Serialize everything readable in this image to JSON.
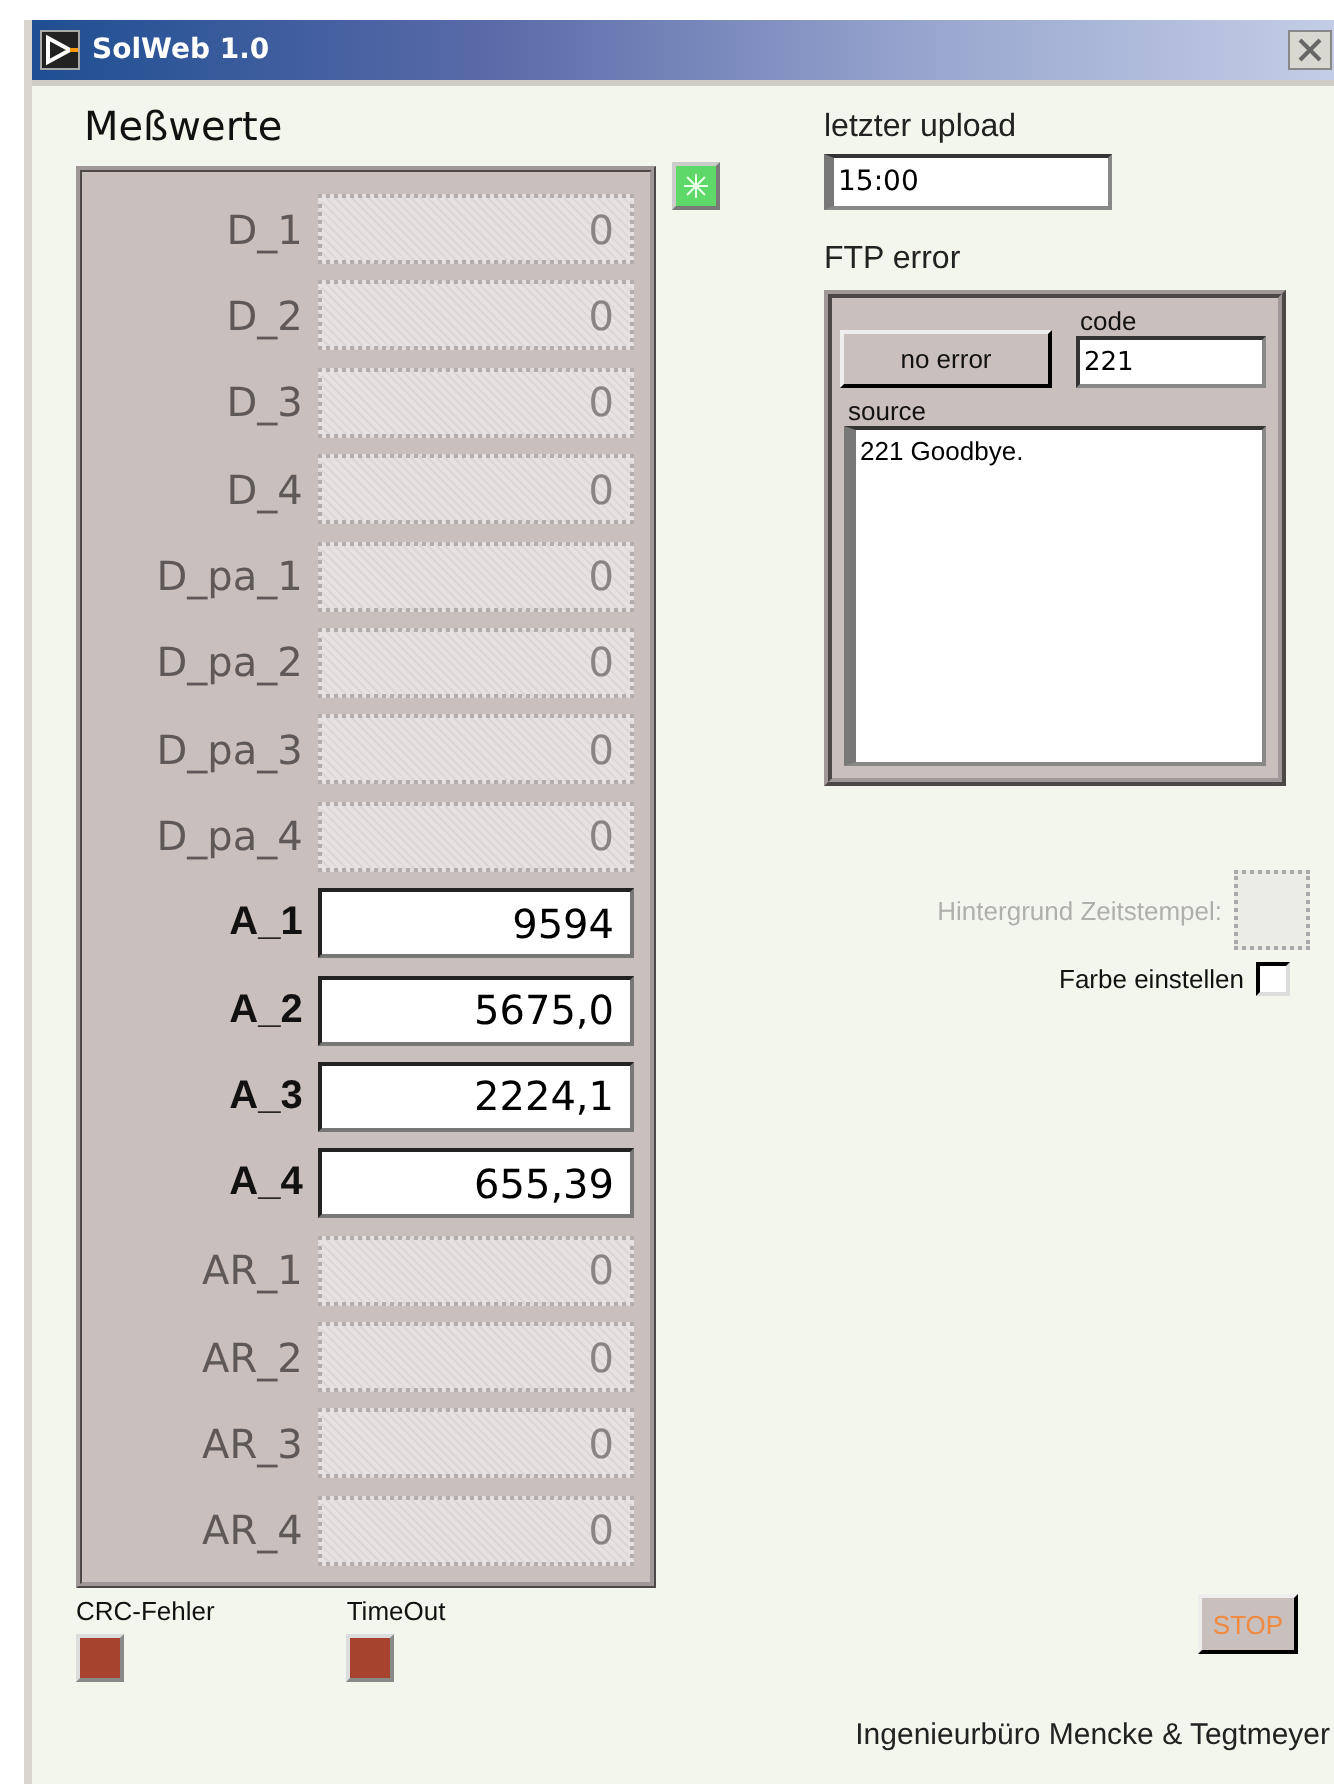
{
  "window": {
    "title": "SolWeb 1.0"
  },
  "measurements": {
    "title": "Meßwerte",
    "rows": [
      {
        "label": "D_1",
        "value": "0",
        "disabled": true
      },
      {
        "label": "D_2",
        "value": "0",
        "disabled": true
      },
      {
        "label": "D_3",
        "value": "0",
        "disabled": true
      },
      {
        "label": "D_4",
        "value": "0",
        "disabled": true
      },
      {
        "label": "D_pa_1",
        "value": "0",
        "disabled": true
      },
      {
        "label": "D_pa_2",
        "value": "0",
        "disabled": true
      },
      {
        "label": "D_pa_3",
        "value": "0",
        "disabled": true
      },
      {
        "label": "D_pa_4",
        "value": "0",
        "disabled": true
      },
      {
        "label": "A_1",
        "value": "9594",
        "disabled": false
      },
      {
        "label": "A_2",
        "value": "5675,0",
        "disabled": false
      },
      {
        "label": "A_3",
        "value": "2224,1",
        "disabled": false
      },
      {
        "label": "A_4",
        "value": "655,39",
        "disabled": false
      },
      {
        "label": "AR_1",
        "value": "0",
        "disabled": true
      },
      {
        "label": "AR_2",
        "value": "0",
        "disabled": true
      },
      {
        "label": "AR_3",
        "value": "0",
        "disabled": true
      },
      {
        "label": "AR_4",
        "value": "0",
        "disabled": true
      }
    ],
    "status_led": {
      "on": true
    }
  },
  "indicators": [
    {
      "label": "CRC-Fehler",
      "on": false
    },
    {
      "label": "TimeOut",
      "on": false
    }
  ],
  "last_upload": {
    "label": "letzter upload",
    "value": "15:00"
  },
  "ftp_error": {
    "label": "FTP error",
    "status_button": "no error",
    "code_label": "code",
    "code": "221",
    "source_label": "source",
    "source": "221 Goodbye."
  },
  "timestamp_background": {
    "label": "Hintergrund Zeitstempel:",
    "disabled": true
  },
  "set_color": {
    "label": "Farbe einstellen",
    "checked": false
  },
  "stop_button": "STOP",
  "footer": "Ingenieurbüro Mencke & Tegtmeyer"
}
